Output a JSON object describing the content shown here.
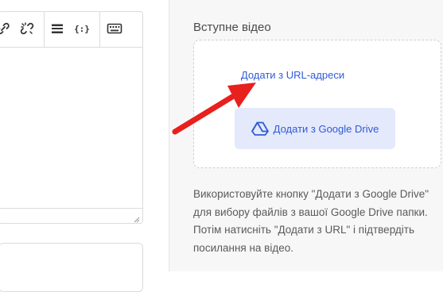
{
  "toolbar": {
    "buttons": [
      {
        "icon": "link-icon"
      },
      {
        "icon": "unlink-icon"
      },
      {
        "icon": "horizontal-rule-icon"
      },
      {
        "icon": "code-braces-icon",
        "label": "{:}"
      },
      {
        "icon": "keyboard-icon"
      }
    ]
  },
  "video_section": {
    "title": "Вступне відео",
    "url_link_label": "Додати з URL-адреси",
    "gdrive_button_label": "Додати з Google Drive",
    "gdrive_icon": "google-drive-icon",
    "help_text": "Використовуйте кнопку \"Додати з Google Drive\" для вибору файлів з вашої Google Drive папки. Потім натисніть \"Додати з URL\" і підтвердіть посилання на відео."
  },
  "annotation": {
    "icon": "red-arrow-pointer",
    "color": "#e8201e"
  },
  "colors": {
    "accent": "#2f5bd6",
    "button_bg": "#e4e9fb",
    "panel_bg": "#f7f7f8"
  }
}
